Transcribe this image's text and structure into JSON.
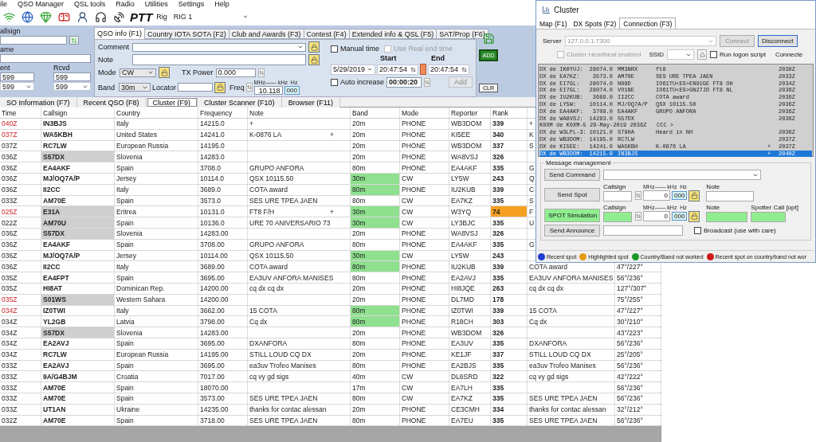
{
  "menu": [
    "ile",
    "QSO Manager",
    "QSL tools",
    "Radio",
    "Utilities",
    "Settings",
    "Help"
  ],
  "toolbar": {
    "ptt": "PTT",
    "rig_label": "Rig",
    "rig": "RIG 1"
  },
  "callsign_form": {
    "callsign_label": "allsign",
    "name_label": "ame",
    "sent_label": "ent",
    "rcvd_label": "Rcvd",
    "sent": "599",
    "rcvd": "599",
    "sent_option": "599",
    "rcvd_option": "599"
  },
  "qso_tabs": [
    {
      "label": "QSO info (F1)",
      "selected": true
    },
    {
      "label": "Country IOTA SOTA (F2)",
      "selected": false
    },
    {
      "label": "Club and Awards (F3)",
      "selected": false
    },
    {
      "label": "Contest (F4)",
      "selected": false
    },
    {
      "label": "Extended info & QSL (F5)",
      "selected": false
    },
    {
      "label": "SAT/Prop (F6)",
      "selected": false
    }
  ],
  "qso_info": {
    "comment_label": "Comment",
    "note_label": "Note",
    "mode_label": "Mode",
    "mode": "CW",
    "tx_power_label": "TX Power",
    "tx_power": "0.000",
    "band_label": "Band",
    "band": "30m",
    "locator_label": "Locator",
    "freq_label": "Freq",
    "freq_units": "MHz—— kHz  Hz",
    "freq": "10.118",
    "freq_hz": "000",
    "manual_time": {
      "label": "Manual time",
      "checked": false,
      "disabled": false
    },
    "real_end_time": {
      "label": "Use Real end time",
      "checked": false,
      "disabled": true
    },
    "start_label": "Start",
    "end_label": "End",
    "date": "5/29/2019",
    "start_time": "20:47:54",
    "end_time": "20:47:54",
    "auto_increase": {
      "label": "Auto increase",
      "checked": false,
      "disabled": false
    },
    "increment": "00:00:20",
    "add": "Add"
  },
  "actions": {
    "add": "ADD",
    "clear": "CLR"
  },
  "bottom_tabs": [
    {
      "label": "SO Information (F7)",
      "selected": false
    },
    {
      "label": "Recent QSO (F8)",
      "selected": false
    },
    {
      "label": "Cluster (F9)",
      "selected": true
    },
    {
      "label": "Cluster Scanner (F10)",
      "selected": false
    },
    {
      "label": "Browser (F11)",
      "selected": false
    }
  ],
  "table": {
    "columns": [
      "Time",
      "Callsign",
      "Country",
      "Frequency",
      "Note",
      "Band",
      "Mode",
      "Reporter",
      "Rank"
    ],
    "rows": [
      {
        "time": "040Z",
        "time_alert": true,
        "callsign": "IN3BJS",
        "callsign_shaded": false,
        "country": "Italy",
        "frequency": "14215.0",
        "note": "+",
        "band": "20m",
        "band_highlight": false,
        "mode": "PHONE",
        "reporter": "WB3DOM",
        "rank": "339",
        "rank_highlight": false,
        "column_10": "+"
      },
      {
        "time": "037Z",
        "time_alert": true,
        "callsign": "WA5KBH",
        "callsign_shaded": false,
        "country": "United States",
        "frequency": "14241.0",
        "note": "K-0876 LA",
        "note_flag": "+",
        "band": "20m",
        "band_highlight": false,
        "mode": "PHONE",
        "reporter": "KI5EE",
        "rank": "340",
        "rank_highlight": false,
        "column_10": "K"
      },
      {
        "time": "037Z",
        "time_alert": false,
        "callsign": "RC7LW",
        "callsign_shaded": false,
        "country": "European Russia",
        "frequency": "14195.0",
        "band": "20m",
        "band_highlight": false,
        "mode": "PHONE",
        "reporter": "WB3DOM",
        "rank": "337",
        "rank_highlight": false,
        "column_10": "S"
      },
      {
        "time": "036Z",
        "time_alert": false,
        "callsign": "S57DX",
        "callsign_shaded": true,
        "country": "Slovenia",
        "frequency": "14283.0",
        "band": "20m",
        "band_highlight": false,
        "mode": "PHONE",
        "reporter": "WA8VSJ",
        "rank": "326",
        "rank_highlight": false
      },
      {
        "time": "036Z",
        "time_alert": false,
        "callsign": "EA4AKF",
        "callsign_shaded": false,
        "country": "Spain",
        "frequency": "3708.0",
        "note": "GRUPO ANFORA",
        "band": "80m",
        "band_highlight": false,
        "mode": "PHONE",
        "reporter": "EA4AKF",
        "rank": "335",
        "rank_highlight": false,
        "column_10": "G"
      },
      {
        "time": "036Z",
        "time_alert": false,
        "callsign": "MJ/OQ7A/P",
        "callsign_shaded": false,
        "country": "Jersey",
        "frequency": "10114.0",
        "note": "QSX 10115.50",
        "band": "30m",
        "band_highlight": true,
        "mode": "CW",
        "reporter": "LY5W",
        "rank": "243",
        "rank_highlight": false,
        "column_10": "Q"
      },
      {
        "time": "036Z",
        "time_alert": false,
        "callsign": "II2CC",
        "callsign_shaded": false,
        "country": "Italy",
        "frequency": "3689.0",
        "note": "COTA award",
        "band": "80m",
        "band_highlight": true,
        "mode": "PHONE",
        "reporter": "IU2KUB",
        "rank": "339",
        "rank_highlight": false,
        "column_10": "C"
      },
      {
        "time": "033Z",
        "time_alert": false,
        "callsign": "AM70E",
        "callsign_shaded": false,
        "country": "Spain",
        "frequency": "3573.0",
        "note": "SES URE TPEA JAEN",
        "band": "80m",
        "band_highlight": false,
        "mode": "CW",
        "reporter": "EA7KZ",
        "rank": "335",
        "rank_highlight": false,
        "column_10": "S"
      },
      {
        "time": "025Z",
        "time_alert": true,
        "callsign": "E31A",
        "callsign_shaded": true,
        "country": "Eritrea",
        "frequency": "10131.0",
        "note": "FT8 F/H",
        "note_flag": "+",
        "band": "30m",
        "band_highlight": true,
        "mode": "CW",
        "reporter": "W3YQ",
        "rank": "74",
        "rank_highlight": true,
        "column_10": "F"
      },
      {
        "time": "022Z",
        "time_alert": false,
        "callsign": "AM70U",
        "callsign_shaded": true,
        "country": "Spain",
        "frequency": "10136.0",
        "note": "URE 70 ANIVERSARIO 73",
        "band": "30m",
        "band_highlight": true,
        "mode": "CW",
        "reporter": "LY3BJC",
        "rank": "335",
        "rank_highlight": false,
        "column_10": "U"
      },
      {
        "time": "036Z",
        "time_alert": false,
        "callsign": "S57DX",
        "callsign_shaded": true,
        "country": "Slovenia",
        "frequency": "14283.00",
        "band": "20m",
        "band_highlight": false,
        "mode": "PHONE",
        "reporter": "WA8VSJ",
        "rank": "326",
        "rank_highlight": false
      },
      {
        "time": "036Z",
        "time_alert": false,
        "callsign": "EA4AKF",
        "callsign_shaded": false,
        "country": "Spain",
        "frequency": "3708.00",
        "note": "GRUPO ANFORA",
        "band": "80m",
        "band_highlight": false,
        "mode": "PHONE",
        "reporter": "EA4AKF",
        "rank": "335",
        "rank_highlight": false,
        "column_10": "G"
      },
      {
        "time": "036Z",
        "time_alert": false,
        "callsign": "MJ/OQ7A/P",
        "callsign_shaded": false,
        "country": "Jersey",
        "frequency": "10114.00",
        "note": "QSX 10115.50",
        "band": "30m",
        "band_highlight": true,
        "mode": "CW",
        "reporter": "LY5W",
        "rank": "243",
        "rank_highlight": false
      },
      {
        "time": "036Z",
        "time_alert": false,
        "callsign": "II2CC",
        "callsign_shaded": false,
        "country": "Italy",
        "frequency": "3689.00",
        "note": "COTA award",
        "band": "80m",
        "band_highlight": true,
        "mode": "PHONE",
        "reporter": "IU2KUB",
        "rank": "339",
        "rank_highlight": false,
        "column_10": "COTA award",
        "column_11": "47°/227°"
      },
      {
        "time": "035Z",
        "time_alert": false,
        "callsign": "EA4FPT",
        "callsign_shaded": false,
        "country": "Spain",
        "frequency": "3695.00",
        "note": "EA3UV ANFORA MANISES",
        "band": "80m",
        "band_highlight": false,
        "mode": "PHONE",
        "reporter": "EA2AVJ",
        "rank": "335",
        "rank_highlight": false,
        "column_10": "EA3UV ANFORA MANISES",
        "column_11": "56°/236°"
      },
      {
        "time": "035Z",
        "time_alert": false,
        "callsign": "HI8AT",
        "callsign_shaded": false,
        "country": "Dominican Rep.",
        "frequency": "14200.00",
        "note": "cq dx cq dx",
        "band": "20m",
        "band_highlight": false,
        "mode": "PHONE",
        "reporter": "HI8JQE",
        "rank": "263",
        "rank_highlight": false,
        "column_10": "cq dx cq dx",
        "column_11": "127°/307°"
      },
      {
        "time": "035Z",
        "time_alert": true,
        "callsign": "S01WS",
        "callsign_shaded": true,
        "country": "Western Sahara",
        "frequency": "14200.00",
        "band": "20m",
        "band_highlight": false,
        "mode": "PHONE",
        "reporter": "DL7MD",
        "rank": "178",
        "rank_highlight": false,
        "column_11": "75°/255°"
      },
      {
        "time": "034Z",
        "time_alert": true,
        "callsign": "IZ0TWI",
        "callsign_shaded": false,
        "country": "Italy",
        "frequency": "3662.00",
        "note": "15 COTA",
        "band": "80m",
        "band_highlight": true,
        "mode": "PHONE",
        "reporter": "IZ0TWI",
        "rank": "339",
        "rank_highlight": false,
        "column_10": "15 COTA",
        "column_11": "47°/227°"
      },
      {
        "time": "034Z",
        "time_alert": false,
        "callsign": "YL2GB",
        "callsign_shaded": false,
        "country": "Latvia",
        "frequency": "3798.00",
        "note": "Cq dx",
        "band": "80m",
        "band_highlight": true,
        "mode": "PHONE",
        "reporter": "R18CH",
        "rank": "303",
        "rank_highlight": false,
        "column_10": "Cq dx",
        "column_11": "30°/210°"
      },
      {
        "time": "034Z",
        "time_alert": false,
        "callsign": "S57DX",
        "callsign_shaded": true,
        "country": "Slovenia",
        "frequency": "14283.00",
        "band": "20m",
        "band_highlight": false,
        "mode": "PHONE",
        "reporter": "WB3DOM",
        "rank": "326",
        "rank_highlight": false,
        "column_11": "43°/223°"
      },
      {
        "time": "034Z",
        "time_alert": false,
        "callsign": "EA2AVJ",
        "callsign_shaded": false,
        "country": "Spain",
        "frequency": "3695.00",
        "note": "DXANFORA",
        "band": "80m",
        "band_highlight": false,
        "mode": "PHONE",
        "reporter": "EA3UV",
        "rank": "335",
        "rank_highlight": false,
        "column_10": "DXANFORA",
        "column_11": "56°/236°"
      },
      {
        "time": "034Z",
        "time_alert": false,
        "callsign": "RC7LW",
        "callsign_shaded": false,
        "country": "European Russia",
        "frequency": "14195.00",
        "note": "STILL LOUD CQ DX",
        "band": "20m",
        "band_highlight": false,
        "mode": "PHONE",
        "reporter": "KE1JF",
        "rank": "337",
        "rank_highlight": false,
        "column_10": "STILL LOUD CQ DX",
        "column_11": "25°/205°"
      },
      {
        "time": "033Z",
        "time_alert": false,
        "callsign": "EA2AVJ",
        "callsign_shaded": false,
        "country": "Spain",
        "frequency": "3695.00",
        "note": "ea3uv Trofeo Manises",
        "band": "80m",
        "band_highlight": false,
        "mode": "PHONE",
        "reporter": "EA2BJS",
        "rank": "335",
        "rank_highlight": false,
        "column_10": "ea3uv Trofeo Manises",
        "column_11": "56°/236°"
      },
      {
        "time": "033Z",
        "time_alert": false,
        "callsign": "9A/G4BJM",
        "callsign_shaded": false,
        "country": "Croatia",
        "frequency": "7017.00",
        "note": "cq vy gd sigs",
        "band": "40m",
        "band_highlight": false,
        "mode": "CW",
        "reporter": "DL6SRD",
        "rank": "322",
        "rank_highlight": false,
        "column_10": "cq vy gd sigs",
        "column_11": "42°/222°"
      },
      {
        "time": "033Z",
        "time_alert": false,
        "callsign": "AM70E",
        "callsign_shaded": false,
        "country": "Spain",
        "frequency": "18070.00",
        "band": "17m",
        "band_highlight": false,
        "mode": "CW",
        "reporter": "EA7LH",
        "rank": "335",
        "rank_highlight": false,
        "column_11": "56°/236°"
      },
      {
        "time": "033Z",
        "time_alert": false,
        "callsign": "AM70E",
        "callsign_shaded": false,
        "country": "Spain",
        "frequency": "3573.00",
        "note": "SES URE TPEA JAEN",
        "band": "80m",
        "band_highlight": false,
        "mode": "CW",
        "reporter": "EA7KZ",
        "rank": "335",
        "rank_highlight": false,
        "column_10": "SES URE TPEA JAEN",
        "column_11": "56°/236°"
      },
      {
        "time": "033Z",
        "time_alert": false,
        "callsign": "UT1AN",
        "callsign_shaded": false,
        "country": "Ukraine",
        "frequency": "14235.00",
        "note": "thanks for contac alessan",
        "band": "20m",
        "band_highlight": false,
        "mode": "PHONE",
        "reporter": "CE3CMH",
        "rank": "334",
        "rank_highlight": false,
        "column_10": "thanks for contac alessan",
        "column_11": "32°/212°"
      },
      {
        "time": "032Z",
        "time_alert": false,
        "callsign": "AM70E",
        "callsign_shaded": false,
        "country": "Spain",
        "frequency": "3718.00",
        "note": "SES URE TPEA JAEN",
        "band": "80m",
        "band_highlight": false,
        "mode": "PHONE",
        "reporter": "EA7EU",
        "rank": "335",
        "rank_highlight": false,
        "column_10": "SES URE TPEA JAEN",
        "column_11": "56°/236°"
      }
    ]
  },
  "cluster": {
    "title": "Cluster",
    "tabs": [
      {
        "label": "Map (F1)",
        "selected": false
      },
      {
        "label": "DX Spots (F2)",
        "selected": false
      },
      {
        "label": "Connection (F3)",
        "selected": true
      }
    ],
    "server_label": "Server",
    "server": "127.0.0.1:7300",
    "connect": "Connect",
    "disconnect": "Disconnect",
    "heartbeat": {
      "label": "Cluster Heartbeat enabled",
      "checked": false,
      "disabled": true
    },
    "ssid_label": "SSID",
    "logon_script": {
      "label": "Run logon script",
      "checked": false,
      "disabled": false
    },
    "status": "Connecte",
    "spots": [
      {
        "kind": "spot",
        "spotter": "DX de IK0YUJ:",
        "freq": "28074.0",
        "call": "MM3NRX",
        "comment": "ft8",
        "time": "2030Z",
        "selected": false
      },
      {
        "kind": "spot",
        "spotter": "DX de EA7KZ:",
        "freq": "3573.0",
        "call": "AM70E",
        "comment": "SES URE TPEA JAEN",
        "time": "2033Z",
        "selected": false
      },
      {
        "kind": "spot",
        "spotter": "DX de EI7GL:",
        "freq": "28074.0",
        "call": "N08D",
        "comment": "IO61TU<ES>EN91GE FT8 OH",
        "time": "2034Z",
        "selected": false
      },
      {
        "kind": "spot",
        "spotter": "DX de EI7GL:",
        "freq": "28074.0",
        "call": "VO1NE",
        "comment": "IO61TU<ES>GN27JD FT8 NL",
        "time": "2036Z",
        "selected": false
      },
      {
        "kind": "spot",
        "spotter": "DX de IU2KUB:",
        "freq": "3689.0",
        "call": "II2CC",
        "comment": "COTA award",
        "time": "2036Z",
        "selected": false
      },
      {
        "kind": "spot",
        "spotter": "DX de LY5W:",
        "freq": "10114.0",
        "call": "MJ/OQ7A/P",
        "comment": "QSX 10115.50",
        "time": "2036Z",
        "selected": false
      },
      {
        "kind": "spot",
        "spotter": "DX de EA4AKF:",
        "freq": "3708.0",
        "call": "EA4AKF",
        "comment": "GRUPO ANFORA",
        "time": "2036Z",
        "selected": false
      },
      {
        "kind": "spot",
        "spotter": "DX de WA8VSJ:",
        "freq": "14283.0",
        "call": "S57DX",
        "time": "2036Z",
        "selected": false
      },
      {
        "kind": "message",
        "text": "K0XM de K0XM-5 29-May-2019 2036Z   CCC >",
        "selected": false
      },
      {
        "kind": "spot",
        "spotter": "DX de W3LPL-3:",
        "freq": "10121.0",
        "call": "S79HA",
        "comment": "Heard in NH",
        "time": "2036Z",
        "selected": false
      },
      {
        "kind": "spot",
        "spotter": "DX de WB3DOM:",
        "freq": "14195.0",
        "call": "RC7LW",
        "time": "2037Z",
        "selected": false
      },
      {
        "kind": "spot",
        "spotter": "DX de KI5EE:",
        "freq": "14241.0",
        "call": "WA5KBH",
        "comment": "K-0876 LA",
        "flag": "+",
        "time": "2037Z",
        "selected": false
      },
      {
        "kind": "spot",
        "spotter": "DX de WB3DOM:",
        "freq": "14215.0",
        "call": "IN3BJS",
        "flag": "+",
        "time": "2040Z",
        "selected": true
      }
    ],
    "message_management": {
      "title": "Message management",
      "send_command": "Send Command",
      "send_spot": "Send Spot",
      "spot_simulation": "SPOT Simulation",
      "send_announce": "Send Announce",
      "callsign_label": "Callsign",
      "units": "MHz—— kHz  Hz",
      "freq": "0",
      "hz": "000",
      "note_label": "Note",
      "sim_callsign_label": "Callsign",
      "sim_units": "MHz—— kHz  Hz",
      "sim_freq": "0",
      "sim_hz": "000",
      "sim_note_label": "Note",
      "spotter_label": "Spotter Call [opt]",
      "broadcast": {
        "label": "Broadcast (use with care)",
        "checked": false,
        "disabled": false
      }
    },
    "legend": [
      {
        "label": "Recent spot",
        "color": "#1f3fd0"
      },
      {
        "label": "Highlighted spot",
        "color": "#e59a14"
      },
      {
        "label": "Country/Band not worked",
        "color": "#1b9a2a"
      },
      {
        "label": "Recent spot on country/band not wor",
        "color": "#d01818"
      }
    ]
  }
}
